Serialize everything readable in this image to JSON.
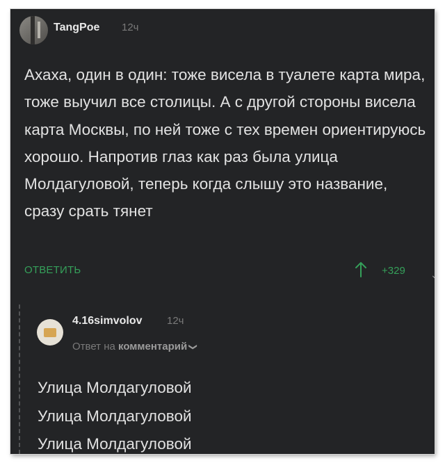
{
  "comment": {
    "author": "TangPoe",
    "time": "12ч",
    "text": "Ахаха, один в один: тоже висела в туалете карта мира, тоже выучил все столицы. А с другой стороны висела карта Москвы, по ней тоже с тех времен ориентируюсь хорошо. Напротив глаз как раз была улица Молдагуловой, теперь когда слышу это название, сразу срать тянет",
    "reply_label": "ОТВЕТИТЬ",
    "rating": "+329",
    "upvote_icon": "arrow-up-icon",
    "colors": {
      "background": "#232426",
      "accent": "#35a05a",
      "text": "#e2e2e2",
      "muted": "#7a7a7a"
    }
  },
  "reply": {
    "author": "4.16simvolov",
    "time": "12ч",
    "reply_to_prefix": "Ответ на",
    "reply_to_link": "комментарий",
    "chevron_icon": "chevron-down-icon",
    "lines": [
      "Улица Молдагуловой",
      "Улица Молдагуловой",
      "Улица Молдагуловой"
    ]
  }
}
